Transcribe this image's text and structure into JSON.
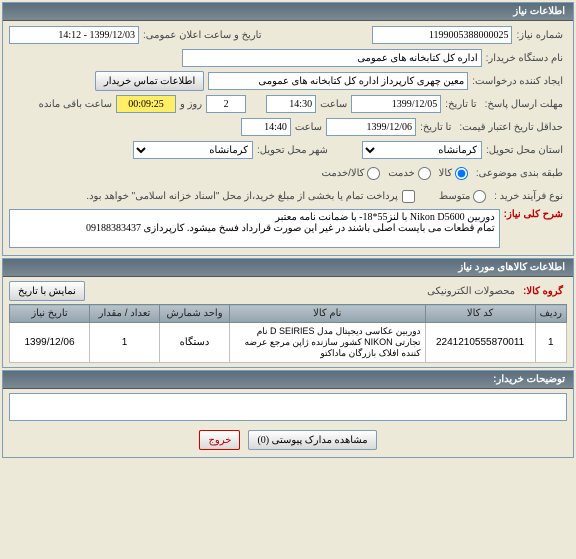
{
  "panel1": {
    "title": "اطلاعات نیاز",
    "need_no_label": "شماره نیاز:",
    "need_no": "1199005388000025",
    "announce_label": "تاریخ و ساعت اعلان عمومی:",
    "announce_val": "1399/12/03 - 14:12",
    "org_label": "نام دستگاه خریدار:",
    "org_val": "اداره کل کتابخانه های عمومی",
    "creator_label": "ایجاد کننده درخواست:",
    "creator_val": "معین چهری کارپرداز اداره کل کتابخانه های عمومی",
    "contact_btn": "اطلاعات تماس خریدار",
    "reply_deadline_label": "مهلت ارسال پاسخ:",
    "deadline_until": "تا تاریخ:",
    "reply_date": "1399/12/05",
    "time_label": "ساعت",
    "reply_time": "14:30",
    "remain_days_lbl": "",
    "remain_days": "2",
    "remain_days_unit": "روز و",
    "remain_time": "00:09:25",
    "remain_time_unit": "ساعت باقی مانده",
    "price_valid_label": "حداقل تاریخ اعتبار قیمت:",
    "price_valid_until": "تا تاریخ:",
    "price_date": "1399/12/06",
    "price_time": "14:40",
    "deliver_prov_label": "استان محل تحویل:",
    "deliver_prov": "کرمانشاه",
    "deliver_city_label": "شهر محل تحویل:",
    "deliver_city": "کرمانشاه",
    "budget_label": "طبقه بندی موضوعی:",
    "budget_opts": {
      "kala": "کالا",
      "khadamat": "خدمت",
      "kala_khadamat": "کالا/خدمت",
      "medium": "متوسط"
    },
    "buy_type_label": "نوع فرآیند خرید :",
    "checkbox_note": "پرداخت تمام یا بخشی از مبلغ خرید،از محل \"اسناد خزانه اسلامی\" خواهد بود.",
    "desc_label": "شرح کلی نیاز:",
    "desc_text": "دوربین Nikon D5600 با لنز55*18- با ضمانت نامه معتبر\nتمام قطعات می بایست اصلی باشند در غیر این صورت قرارداد فسخ میشود. کارپردازی 09188383437"
  },
  "panel2": {
    "title": "اطلاعات کالاهای مورد نیاز",
    "group_label": "گروه کالا:",
    "group_val": "محصولات الکترونیکی",
    "show_date_btn": "نمایش با تاریخ",
    "cols": {
      "row": "ردیف",
      "code": "کد کالا",
      "name": "نام کالا",
      "unit": "واحد شمارش",
      "qty": "تعداد / مقدار",
      "date": "تاریخ نیاز"
    },
    "items": [
      {
        "row": "1",
        "code": "2241210555870011",
        "name": "دوربین عکاسی دیجیتال مدل D SEIRIES نام تجارتی NIKON کشور سازنده ژاپن مرجع عرضه کننده افلاک بازرگان ماداکتو",
        "unit": "دستگاه",
        "qty": "1",
        "date": "1399/12/06"
      }
    ]
  },
  "panel3": {
    "title": "توضیحات خریدار:",
    "attach_btn": "مشاهده مدارک پیوستی (0)",
    "close_btn": "خروج"
  }
}
